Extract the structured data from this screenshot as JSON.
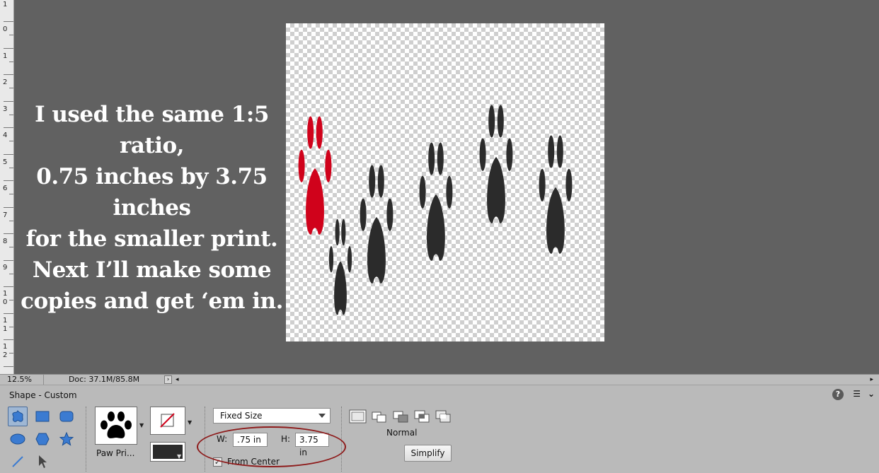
{
  "ruler": {
    "labels": [
      "1",
      "0",
      "1",
      "2",
      "3",
      "4",
      "5",
      "6",
      "7",
      "8",
      "9",
      "1",
      "0",
      "1",
      "1",
      "1",
      "2"
    ]
  },
  "overlay_text": {
    "line1": "I used the same 1:5 ratio,",
    "line2": "0.75 inches by 3.75 inches",
    "line3": "for the smaller print.",
    "line4": "Next I’ll make some",
    "line5": "copies and get ‘em in."
  },
  "canvas": {
    "paw_colors": [
      "#d0021b",
      "#2b2b2b"
    ]
  },
  "statusbar": {
    "zoom": "12.5%",
    "doc": "Doc: 37.1M/85.8M",
    "arrow": "›",
    "scroll_left": "◂",
    "scroll_right": "▸"
  },
  "options": {
    "title": "Shape - Custom",
    "shape_label": "Paw Pri...",
    "size_mode": "Fixed Size",
    "w_label": "W:",
    "w_value": ".75 in",
    "h_label": "H:",
    "h_value": "3.75 in",
    "from_center_label": "From Center",
    "from_center_checked": true,
    "mode_label": "Normal",
    "simplify_label": "Simplify",
    "help_icon": "?",
    "menu_icon": "☰",
    "collapse_icon": "⌄"
  },
  "colors": {
    "workspace": "#616161",
    "accent_selected": "#9fb7d4",
    "annotation": "#8e1b1b",
    "shape_fill": "#3b7bd1"
  }
}
